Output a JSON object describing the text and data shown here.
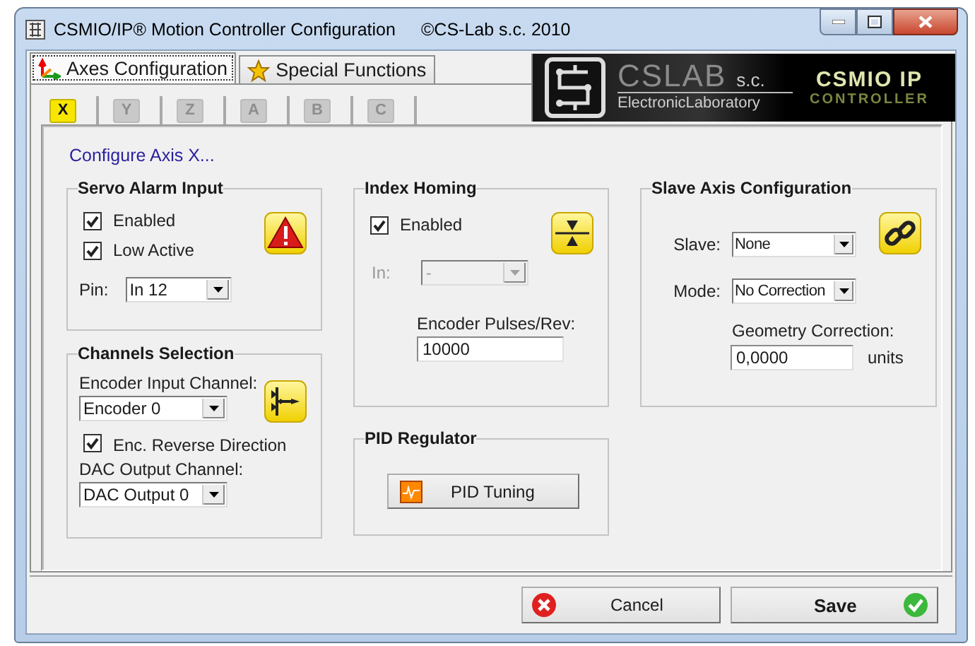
{
  "window": {
    "title": "CSMIO/IP® Motion Controller Configuration",
    "copyright": "©CS-Lab s.c. 2010"
  },
  "main_tabs": [
    {
      "label": "Axes Configuration",
      "selected": true,
      "kind": "axes"
    },
    {
      "label": "Special Functions",
      "selected": false,
      "kind": "star"
    }
  ],
  "logo": {
    "brand": "CSLAB",
    "suffix": "s.c.",
    "subtitle": "ElectronicLaboratory",
    "product": "CSMIO IP",
    "product_subtitle": "CONTROLLER"
  },
  "axis_tabs": [
    {
      "label": "X",
      "selected": true
    },
    {
      "label": "Y",
      "selected": false
    },
    {
      "label": "Z",
      "selected": false
    },
    {
      "label": "A",
      "selected": false
    },
    {
      "label": "B",
      "selected": false
    },
    {
      "label": "C",
      "selected": false
    }
  ],
  "heading": "Configure Axis X...",
  "servo_alarm": {
    "title": "Servo Alarm Input",
    "checks": [
      {
        "label": "Enabled",
        "checked": true
      },
      {
        "label": "Low Active",
        "checked": true
      }
    ],
    "pin": {
      "label": "Pin:",
      "value": "In 12"
    }
  },
  "channels_selection": {
    "title": "Channels Selection",
    "encoder_label": "Encoder Input Channel:",
    "encoder_value": "Encoder 0",
    "reverse": {
      "label": "Enc. Reverse Direction",
      "checked": true
    },
    "dac_label": "DAC Output Channel:",
    "dac_value": "DAC Output 0"
  },
  "index_homing": {
    "title": "Index Homing",
    "enabled": {
      "label": "Enabled",
      "checked": true
    },
    "input": {
      "label": "In:",
      "value": "-",
      "disabled": true
    },
    "pulses_label": "Encoder Pulses/Rev:",
    "pulses_value": "10000"
  },
  "pid_regulator": {
    "title": "PID Regulator",
    "button": "PID Tuning"
  },
  "slave_axis": {
    "title": "Slave Axis Configuration",
    "slave": {
      "label": "Slave:",
      "value": "None"
    },
    "mode": {
      "label": "Mode:",
      "value": "No Correction"
    },
    "geometry_label": "Geometry Correction:",
    "geometry_value": "0,0000",
    "units": "units"
  },
  "buttons": [
    {
      "label": "Cancel",
      "kind": "cancel"
    },
    {
      "label": "Save",
      "kind": "save"
    }
  ]
}
